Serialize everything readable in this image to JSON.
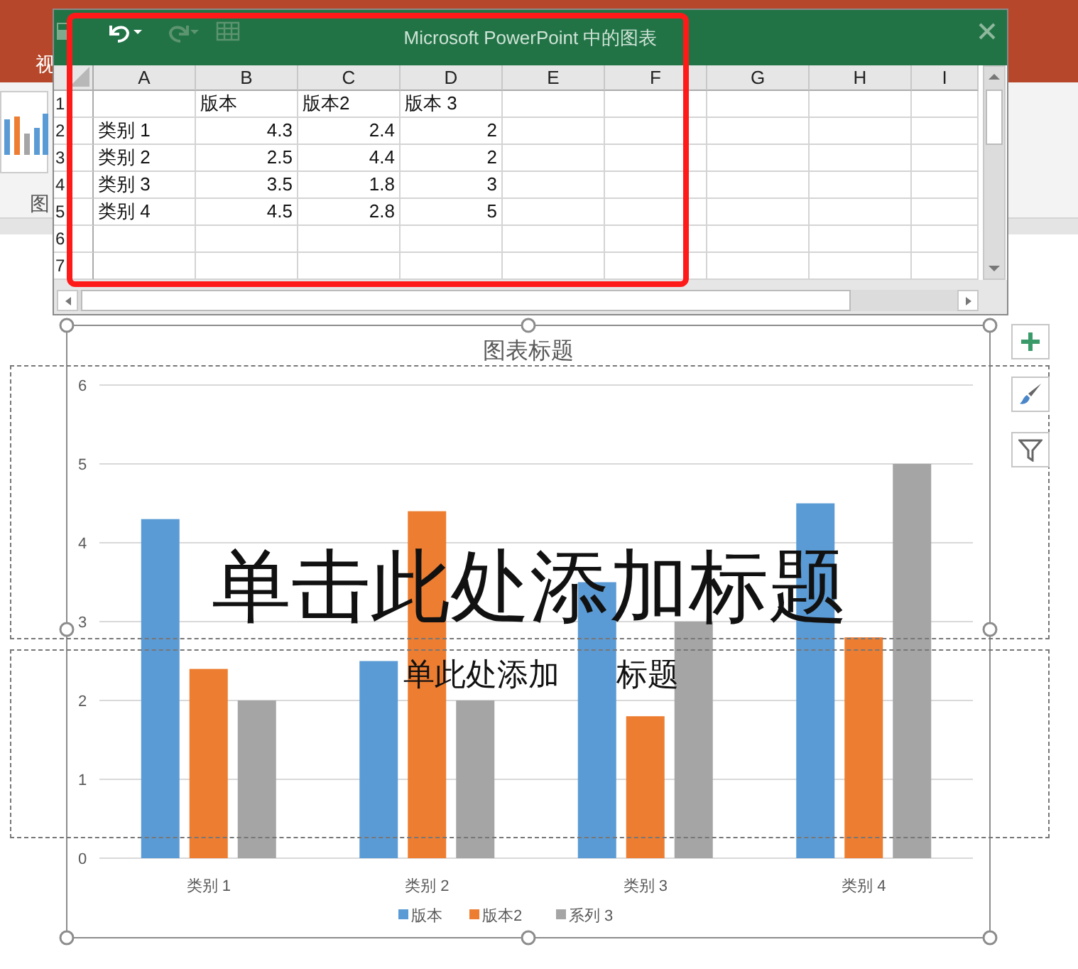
{
  "app": {
    "ribbon_tab_partial": "视",
    "panel_label_partial": "图"
  },
  "data_window": {
    "title": "Microsoft PowerPoint 中的图表",
    "columns": [
      "A",
      "B",
      "C",
      "D",
      "E",
      "F",
      "G",
      "H",
      "I"
    ],
    "header_row": {
      "number": "1",
      "labels": [
        "版本",
        "版本2",
        "版本 3"
      ]
    },
    "rows": [
      {
        "number": "2",
        "category": "类别 1",
        "values": [
          "4.3",
          "2.4",
          "2"
        ]
      },
      {
        "number": "3",
        "category": "类别 2",
        "values": [
          "2.5",
          "4.4",
          "2"
        ]
      },
      {
        "number": "4",
        "category": "类别 3",
        "values": [
          "3.5",
          "1.8",
          "3"
        ]
      },
      {
        "number": "5",
        "category": "类别 4",
        "values": [
          "4.5",
          "2.8",
          "5"
        ]
      },
      {
        "number": "6"
      },
      {
        "number": "7"
      }
    ]
  },
  "slide": {
    "title_placeholder": "单击此处添加标题",
    "subtitle_fragments": [
      "单",
      "此处添加",
      "标题"
    ],
    "chart": {
      "chart_data": {
        "type": "bar",
        "title": "图表标题",
        "categories": [
          "类别 1",
          "类别 2",
          "类别 3",
          "类别 4"
        ],
        "series": [
          {
            "name": "版本",
            "color": "#5b9bd5",
            "values": [
              4.3,
              2.5,
              3.5,
              4.5
            ]
          },
          {
            "name": "版本2",
            "color": "#ed7d31",
            "values": [
              2.4,
              4.4,
              1.8,
              2.8
            ]
          },
          {
            "name": "系列 3",
            "color": "#a5a5a5",
            "values": [
              2,
              2,
              3,
              5
            ]
          }
        ],
        "ylim": [
          0,
          6
        ],
        "yticks": [
          0,
          1,
          2,
          3,
          4,
          5,
          6
        ],
        "grid": true,
        "legend": true
      }
    }
  }
}
